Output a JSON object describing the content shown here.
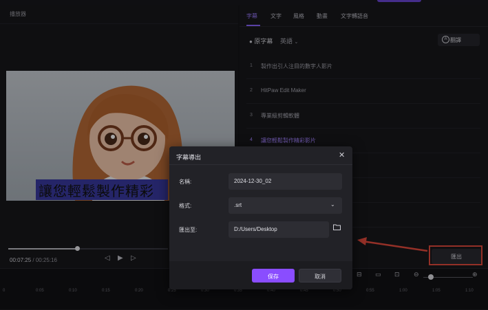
{
  "player": {
    "title": "播放器",
    "subtitle_overlay": "讓您輕鬆製作精彩",
    "progress_percent": 43,
    "time_current": "00:07:25",
    "time_separator": " / ",
    "time_total": "00:25:16",
    "controls": {
      "prev": "◁",
      "play": "▶",
      "next": "▷"
    }
  },
  "tabs": [
    {
      "label": "字幕",
      "active": true
    },
    {
      "label": "文字",
      "active": false
    },
    {
      "label": "風格",
      "active": false
    },
    {
      "label": "動畫",
      "active": false
    },
    {
      "label": "文字轉語音",
      "active": false
    }
  ],
  "subtitle_panel": {
    "original_label": "原字幕",
    "language": "英語",
    "translate_label": "翻譯",
    "rows": [
      {
        "num": "1",
        "text": "製作出引人注目的數字人影片",
        "active": false
      },
      {
        "num": "2",
        "text": "HitPaw Edit Maker",
        "active": false
      },
      {
        "num": "3",
        "text": "專業級剪輯軟體",
        "active": false
      },
      {
        "num": "4",
        "text": "讓您輕鬆製作精彩影片",
        "active": true
      }
    ],
    "export_label": "匯出"
  },
  "timeline": {
    "ticks": [
      "0",
      "0:05",
      "0:10",
      "0:15",
      "0:20",
      "0:25",
      "0:30",
      "0:35",
      "0:40",
      "0:45",
      "0:50",
      "0:55",
      "1:00",
      "1:05",
      "1:10"
    ]
  },
  "modal": {
    "title": "字幕導出",
    "close": "✕",
    "name_label": "名稱:",
    "name_value": "2024-12-30_02",
    "format_label": "格式:",
    "format_value": ".srt",
    "path_label": "匯出至:",
    "path_value": "D:/Users/Desktop",
    "save_label": "保存",
    "cancel_label": "取消"
  },
  "colors": {
    "accent": "#8a4dff",
    "highlight": "#e34a3d"
  }
}
